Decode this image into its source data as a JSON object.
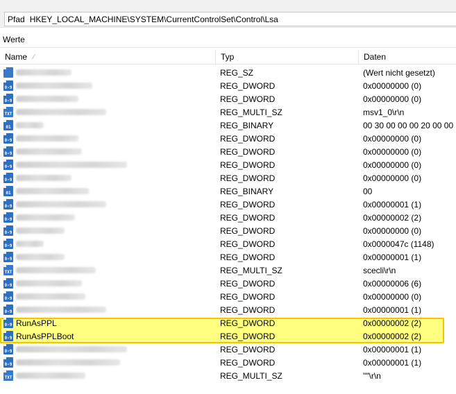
{
  "path_bar": {
    "label": "Pfad",
    "value": "HKEY_LOCAL_MACHINE\\SYSTEM\\CurrentControlSet\\Control\\Lsa"
  },
  "section_title": "Werte",
  "columns": {
    "name": "Name",
    "type": "Typ",
    "data": "Daten"
  },
  "rows": [
    {
      "name": "",
      "type": "REG_SZ",
      "data": "(Wert nicht gesetzt)",
      "icon": "string-value-icon"
    },
    {
      "name": "",
      "type": "REG_DWORD",
      "data": "0x00000000 (0)",
      "icon": "dword-value-icon"
    },
    {
      "name": "",
      "type": "REG_DWORD",
      "data": "0x00000000 (0)",
      "icon": "dword-value-icon"
    },
    {
      "name": "",
      "type": "REG_MULTI_SZ",
      "data": "msv1_0\\r\\n",
      "icon": "multi-string-value-icon"
    },
    {
      "name": "",
      "type": "REG_BINARY",
      "data": "00 30 00 00 00 20 00 00",
      "icon": "binary-value-icon"
    },
    {
      "name": "",
      "type": "REG_DWORD",
      "data": "0x00000000 (0)",
      "icon": "dword-value-icon"
    },
    {
      "name": "",
      "type": "REG_DWORD",
      "data": "0x00000000 (0)",
      "icon": "dword-value-icon"
    },
    {
      "name": "",
      "type": "REG_DWORD",
      "data": "0x00000000 (0)",
      "icon": "dword-value-icon"
    },
    {
      "name": "",
      "type": "REG_DWORD",
      "data": "0x00000000 (0)",
      "icon": "dword-value-icon"
    },
    {
      "name": "",
      "type": "REG_BINARY",
      "data": "00",
      "icon": "binary-value-icon"
    },
    {
      "name": "",
      "type": "REG_DWORD",
      "data": "0x00000001 (1)",
      "icon": "dword-value-icon"
    },
    {
      "name": "",
      "type": "REG_DWORD",
      "data": "0x00000002 (2)",
      "icon": "dword-value-icon"
    },
    {
      "name": "",
      "type": "REG_DWORD",
      "data": "0x00000000 (0)",
      "icon": "dword-value-icon"
    },
    {
      "name": "",
      "type": "REG_DWORD",
      "data": "0x0000047c (1148)",
      "icon": "dword-value-icon"
    },
    {
      "name": "",
      "type": "REG_DWORD",
      "data": "0x00000001 (1)",
      "icon": "dword-value-icon"
    },
    {
      "name": "",
      "type": "REG_MULTI_SZ",
      "data": "scecli\\r\\n",
      "icon": "multi-string-value-icon"
    },
    {
      "name": "",
      "type": "REG_DWORD",
      "data": "0x00000006 (6)",
      "icon": "dword-value-icon"
    },
    {
      "name": "",
      "type": "REG_DWORD",
      "data": "0x00000000 (0)",
      "icon": "dword-value-icon"
    },
    {
      "name": "",
      "type": "REG_DWORD",
      "data": "0x00000001 (1)",
      "icon": "dword-value-icon"
    },
    {
      "name": "RunAsPPL",
      "type": "REG_DWORD",
      "data": "0x00000002 (2)",
      "icon": "dword-value-icon"
    },
    {
      "name": "RunAsPPLBoot",
      "type": "REG_DWORD",
      "data": "0x00000002 (2)",
      "icon": "dword-value-icon"
    },
    {
      "name": "",
      "type": "REG_DWORD",
      "data": "0x00000001 (1)",
      "icon": "dword-value-icon"
    },
    {
      "name": "",
      "type": "REG_DWORD",
      "data": "0x00000001 (1)",
      "icon": "dword-value-icon"
    },
    {
      "name": "",
      "type": "REG_MULTI_SZ",
      "data": "\"\"\\r\\n",
      "icon": "multi-string-value-icon"
    }
  ],
  "highlight_color": "#ffff80",
  "highlight_border": "#f2c500"
}
